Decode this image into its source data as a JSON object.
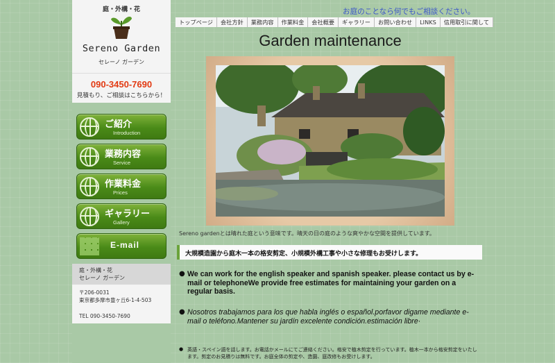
{
  "sidebar": {
    "logo": {
      "top_text": "庭・外構・花",
      "name": "Sereno Garden",
      "kana": "セレーノ ガーデン"
    },
    "phone": "090-3450-7690",
    "phone_note": "見積もり、ご相談はこちらから！",
    "nav": [
      {
        "label": "ご紹介",
        "sub": "Introduction",
        "icon": "globe-icon"
      },
      {
        "label": "業務内容",
        "sub": "Service",
        "icon": "globe-icon"
      },
      {
        "label": "作業料金",
        "sub": "Prices",
        "icon": "globe-icon"
      },
      {
        "label": "ギャラリー",
        "sub": "Gallery",
        "icon": "globe-icon"
      },
      {
        "label": "E-mail",
        "sub": "",
        "icon": "mail-grid-icon"
      }
    ],
    "company": {
      "line1": "庭・外構・花",
      "line2": "セレーノ ガーデン",
      "postal": "〒206-0031",
      "address": "東京都多摩市豊ヶ丘6-1-4-503",
      "tel": "TEL 090-3450-7690"
    }
  },
  "header": {
    "tagline": "お庭のことなら何でもご相談ください。",
    "topnav": [
      "トップページ",
      "会社方針",
      "業務内容",
      "作業料金",
      "会社概要",
      "ギャラリー",
      "お問い合わせ",
      "LINKS",
      "信用取引に関して"
    ]
  },
  "main": {
    "title": "Garden maintenance",
    "caption": "Sereno gardenとは晴れた庭という意味です。晴天の日の庭のような爽やかな空間を提供しています。",
    "notice": "大規模造園から庭木一本の格安剪定、小規模外構工事や小さな修理もお受けします。",
    "english": "We can work for the english speaker and spanish speaker. please contact us by e-mail or telephoneWe provide free estimates for maintaining your garden on a regular basis.",
    "spanish": "Nosotros trabajamos para los que habla inglés o español.porfavor digame mediante e-mail o teléfono.Mantener su jardín excelente condición.estimación libre·",
    "footnote": "英語・スペイン語を話します。お電話かメールにてご連絡ください。格安で植木剪定を行っています。植木一本から格安剪定をいたします。剪定のお見積りは無料です。お庭全体の剪定や、造園、庭改修もお受けします。"
  },
  "colors": {
    "background": "#a9c9a6",
    "phone": "#e23a12",
    "tagline": "#3a55c8",
    "nav_green": "#4a8a18"
  }
}
